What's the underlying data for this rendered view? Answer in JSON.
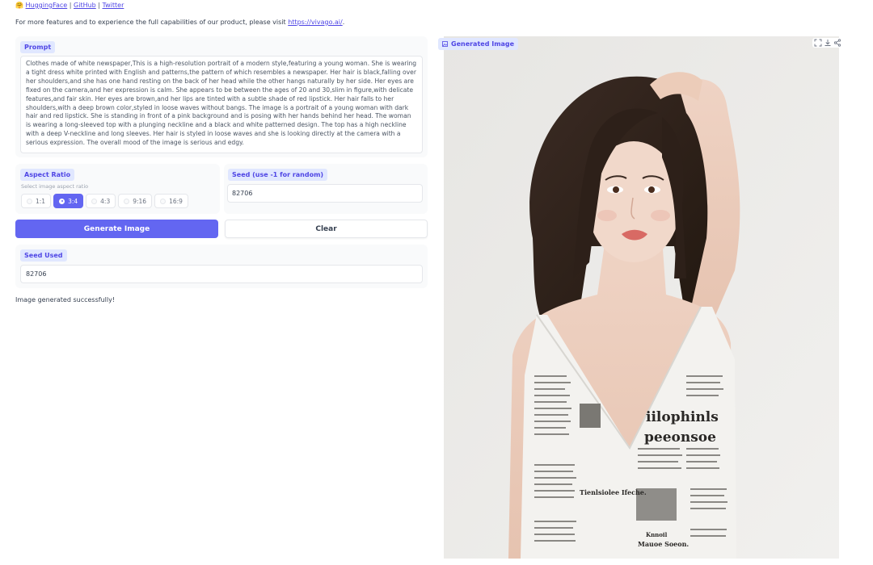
{
  "header": {
    "emoji": "🤗",
    "links": [
      "HuggingFace",
      "GitHub",
      "Twitter"
    ],
    "separator": "|",
    "intro_text": "For more features and to experience the full capabilities of our product, please visit ",
    "intro_link": "https://vivago.ai/",
    "intro_end": "."
  },
  "prompt": {
    "label": "Prompt",
    "value": "Clothes made of white newspaper,This is a high-resolution portrait of a modern style,featuring a young woman. She is wearing a tight dress white printed with English and patterns,the pattern of which resembles a newspaper. Her hair is black,falling over her shoulders,and she has one hand resting on the back of her head while the other hangs naturally by her side. Her eyes are fixed on the camera,and her expression is calm. She appears to be between the ages of 20 and 30,slim in figure,with delicate features,and fair skin. Her eyes are brown,and her lips are tinted with a subtle shade of red lipstick. Her hair falls to her shoulders,with a deep brown color,styled in loose waves without bangs. The image is a portrait of a young woman with dark hair and red lipstick. She is standing in front of a pink background and is posing with her hands behind her head. The woman is wearing a long-sleeved top with a plunging neckline and a black and white patterned design. The top has a high neckline with a deep V-neckline and long sleeves. Her hair is styled in loose waves and she is looking directly at the camera with a serious expression. The overall mood of the image is serious and edgy."
  },
  "aspect_ratio": {
    "label": "Aspect Ratio",
    "help": "Select image aspect ratio",
    "options": [
      "1:1",
      "3:4",
      "4:3",
      "9:16",
      "16:9"
    ],
    "selected": "3:4"
  },
  "seed": {
    "label": "Seed (use -1 for random)",
    "value": "82706"
  },
  "buttons": {
    "generate": "Generate Image",
    "clear": "Clear"
  },
  "seed_used": {
    "label": "Seed Used",
    "value": "82706"
  },
  "status": "Image generated successfully!",
  "output": {
    "label": "Generated Image",
    "tools": [
      "fullscreen-icon",
      "download-icon",
      "share-icon"
    ],
    "newspaper_headlines": [
      "iilophinls",
      "peeonsoe",
      "Tienlsiolee Ifeche.",
      "Knnoil",
      "Mauoe Soeon."
    ]
  },
  "colors": {
    "accent": "#6366f1",
    "tag_bg": "#e0e7ff",
    "tag_text": "#4f46e5",
    "background_wall": "#ececea",
    "lips": "#d86a64"
  }
}
